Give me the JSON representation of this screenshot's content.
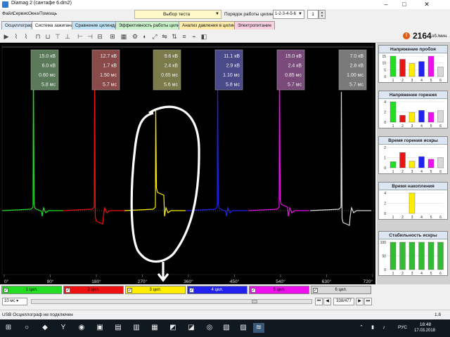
{
  "window": {
    "title": "Diamag 2 (сантафе 6.dm2)"
  },
  "menu": [
    "Файл",
    "Сервис",
    "Окна",
    "Помощь"
  ],
  "test_select": {
    "label": "Выбор теста"
  },
  "cylinder_order": {
    "label": "Порядок работы цилиндров",
    "value": "1-2-3-4-5-6",
    "count": "1"
  },
  "tabs": [
    {
      "label": "Осциллограф",
      "color": "#dfeaf7"
    },
    {
      "label": "Система зажигания",
      "color": "#ffffff"
    },
    {
      "label": "Сравнение цилиндров",
      "color": "#bfe2f5"
    },
    {
      "label": "Эффективность работы цилиндров",
      "color": "#c9f0c9"
    },
    {
      "label": "Анализ давления в цилиндре",
      "color": "#fde9a8"
    },
    {
      "label": "Электропитание",
      "color": "#f8d0e0"
    }
  ],
  "rpm": {
    "value": "2164",
    "unit": "об./мин."
  },
  "cylinders": [
    {
      "num": "1",
      "label": "1 цил.",
      "color": "#22dd22",
      "breakdown_kv": "15.0 кВ",
      "burn_kv": "6.0 кВ",
      "burn_ms": "0.60 мс",
      "dwell_ms": "5.8 мс",
      "box": "#5a7a5a"
    },
    {
      "num": "2",
      "label": "2 цил.",
      "color": "#ee1111",
      "breakdown_kv": "12.7 кВ",
      "burn_kv": "1.7 кВ",
      "burn_ms": "1.50 мс",
      "dwell_ms": "5.7 мс",
      "box": "#8a4a4a"
    },
    {
      "num": "3",
      "label": "3 цил.",
      "color": "#ffee00",
      "breakdown_kv": "9.6 кВ",
      "burn_kv": "2.4 кВ",
      "burn_ms": "0.65 мс",
      "dwell_ms": "5.6 мс",
      "box": "#7a7a4a"
    },
    {
      "num": "4",
      "label": "4 цил.",
      "color": "#2222ee",
      "breakdown_kv": "11.1 кВ",
      "burn_kv": "2.9 кВ",
      "burn_ms": "1.10 мс",
      "dwell_ms": "5.8 мс",
      "box": "#4a4a8a"
    },
    {
      "num": "5",
      "label": "5 цил.",
      "color": "#ee11ee",
      "breakdown_kv": "15.0 кВ",
      "burn_kv": "2.4 кВ",
      "burn_ms": "0.85 мс",
      "dwell_ms": "5.7 мс",
      "box": "#7a4a7a"
    },
    {
      "num": "6",
      "label": "6 цил.",
      "color": "#d8d8d8",
      "breakdown_kv": "7.0 кВ",
      "burn_kv": "2.8 кВ",
      "burn_ms": "1.00 мс",
      "dwell_ms": "5.7 мс",
      "box": "#7a7a7a"
    }
  ],
  "x_axis_ticks": [
    "0°",
    "90°",
    "180°",
    "270°",
    "360°",
    "450°",
    "540°",
    "630°",
    "720°"
  ],
  "panels": [
    {
      "title": "Напряжение пробоя",
      "yticks": [
        "15",
        "10",
        "5",
        "0"
      ],
      "xticks": [
        "1",
        "2",
        "3",
        "4",
        "5",
        "6"
      ]
    },
    {
      "title": "Напряжение горения",
      "yticks": [
        "4",
        "2",
        "0"
      ],
      "xticks": [
        "1",
        "2",
        "3",
        "4",
        "5",
        "6"
      ]
    },
    {
      "title": "Время горения искры",
      "yticks": [
        "2",
        "1",
        "0"
      ],
      "xticks": [
        "1",
        "2",
        "3",
        "4",
        "5",
        "6"
      ]
    },
    {
      "title": "Время накопления",
      "yticks": [
        "4",
        "2",
        "0"
      ],
      "xticks": [
        "1",
        "2",
        "3",
        "4",
        "5",
        "6"
      ]
    },
    {
      "title": "Стабильность искры",
      "yticks": [
        "100",
        "50",
        "0"
      ],
      "xticks": [
        "1",
        "2",
        "3",
        "4",
        "5",
        "6"
      ]
    }
  ],
  "bottom": {
    "time_scale": "10 мс",
    "frame": "338/477"
  },
  "status": {
    "text": "USB Осциллограф не подключен",
    "version": "1.8"
  },
  "taskbar": {
    "lang": "РУС",
    "time": "18:48",
    "date": "17.03.2018"
  }
}
